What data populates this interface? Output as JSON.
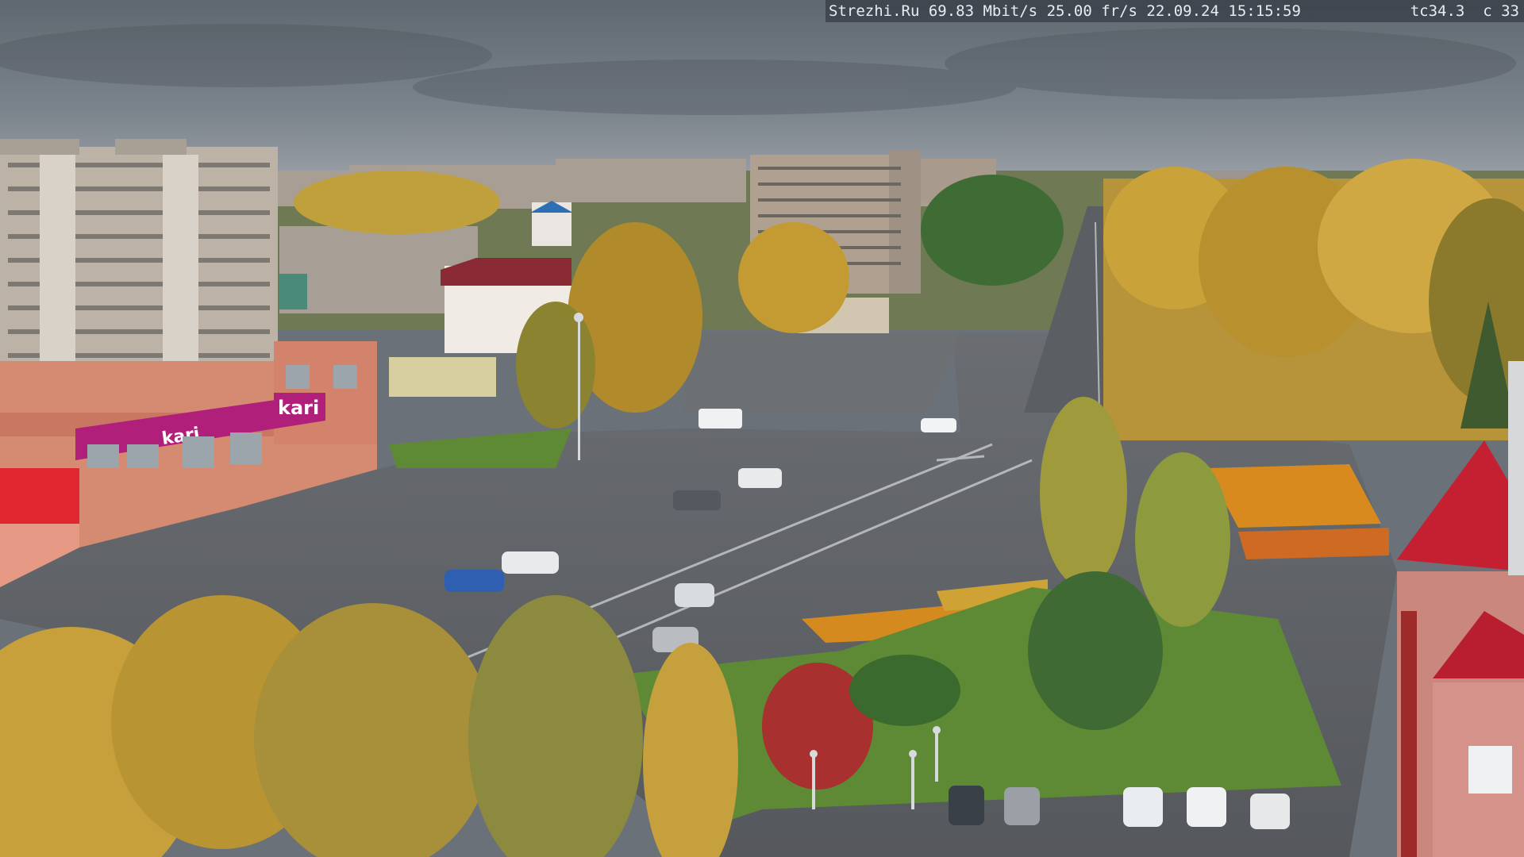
{
  "overlay": {
    "site": "Strezhi.Ru",
    "bitrate": "69.83 Mbit/s",
    "framerate": "25.00 fr/s",
    "date": "22.09.24",
    "time": "15:15:59",
    "tc": "tc34.3",
    "channel": "c 33"
  },
  "signs": {
    "store_logo": "kari",
    "store_banner": "kari"
  },
  "colors": {
    "sky": "#717982",
    "asphalt": "#5c5f63",
    "lawn": "#5f8a35",
    "autumn_foliage": "#c9a23a",
    "store_magenta": "#b0207a",
    "store_red": "#e0262f",
    "facade_brick": "#c99080"
  }
}
